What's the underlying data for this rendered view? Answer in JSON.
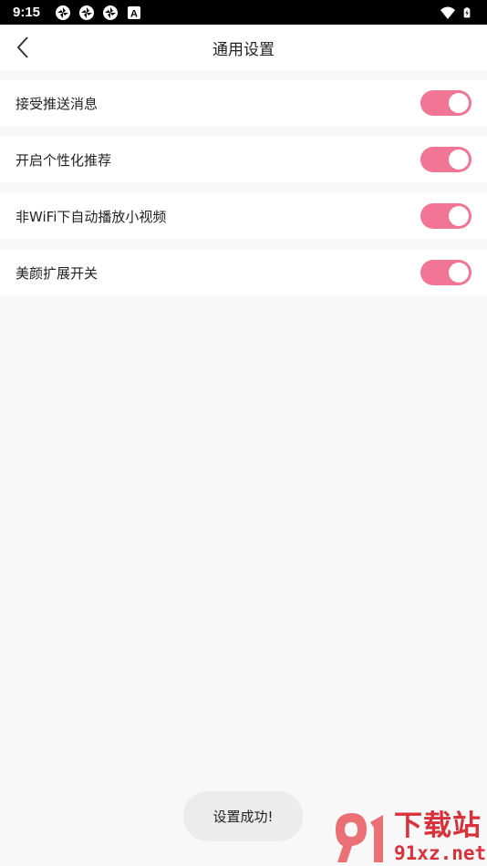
{
  "status_bar": {
    "time": "9:15",
    "icons": [
      "aperture-icon",
      "aperture-icon",
      "aperture-icon",
      "a-letter-icon"
    ],
    "a_label": "A",
    "right_icons": [
      "wifi-icon",
      "battery-charging-icon"
    ]
  },
  "header": {
    "title": "通用设置",
    "back_icon": "chevron-left-icon"
  },
  "settings": [
    {
      "label": "接受推送消息",
      "enabled": true
    },
    {
      "label": "开启个性化推荐",
      "enabled": true
    },
    {
      "label": "非WiFi下自动播放小视频",
      "enabled": true
    },
    {
      "label": "美颜扩展开关",
      "enabled": true
    }
  ],
  "toast": {
    "text": "设置成功!"
  },
  "watermark": {
    "text_cn": "下载站",
    "url": "91xz.net"
  },
  "colors": {
    "toggle_on": "#f27595",
    "background": "#f8f8f8",
    "watermark": "#d9303a"
  }
}
